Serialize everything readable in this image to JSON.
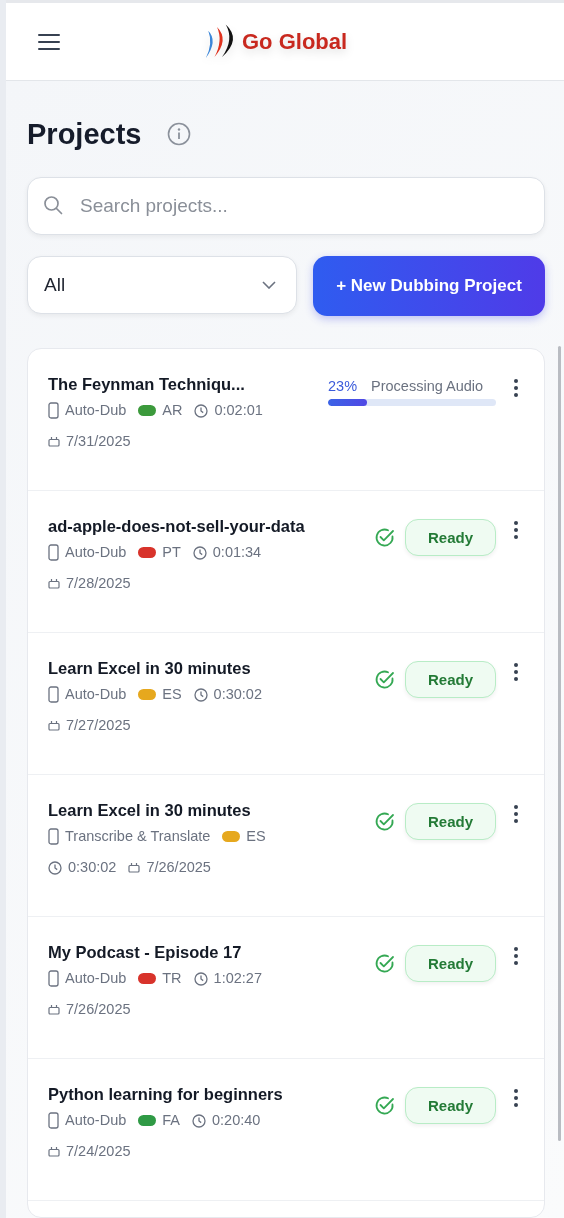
{
  "header": {
    "logo": "Go Global"
  },
  "page": {
    "title": "Projects"
  },
  "search": {
    "placeholder": "Search projects..."
  },
  "filter": {
    "value": "All"
  },
  "new_button": {
    "label": "+ New Dubbing Project"
  },
  "projects": [
    {
      "title": "The Feynman Techniqu...",
      "mode": "Auto-Dub",
      "language": {
        "code": "AR",
        "color": "#3c9a3c"
      },
      "duration": "0:02:01",
      "date": "7/31/2025",
      "status": {
        "kind": "processing",
        "percent": "23%",
        "label": "Processing Audio",
        "level": 0.23
      }
    },
    {
      "title": "ad-apple-does-not-sell-your-data",
      "mode": "Auto-Dub",
      "language": {
        "code": "PT",
        "color": "#d8332b"
      },
      "duration": "0:01:34",
      "date": "7/28/2025",
      "status": {
        "kind": "ready",
        "label": "Ready"
      }
    },
    {
      "title": "Learn Excel in 30 minutes",
      "mode": "Auto-Dub",
      "language": {
        "code": "ES",
        "color": "#e6a81e"
      },
      "duration": "0:30:02",
      "date": "7/27/2025",
      "status": {
        "kind": "ready",
        "label": "Ready"
      }
    },
    {
      "title": "Learn Excel in 30 minutes",
      "mode": "Transcribe & Translate",
      "language": {
        "code": "ES",
        "color": "#e6a81e"
      },
      "duration": "0:30:02",
      "date": "7/26/2025",
      "status": {
        "kind": "ready",
        "label": "Ready"
      }
    },
    {
      "title": "My Podcast - Episode 17",
      "mode": "Auto-Dub",
      "language": {
        "code": "TR",
        "color": "#d8332b"
      },
      "duration": "1:02:27",
      "date": "7/26/2025",
      "status": {
        "kind": "ready",
        "label": "Ready"
      }
    },
    {
      "title": "Python learning for beginners",
      "mode": "Auto-Dub",
      "language": {
        "code": "FA",
        "color": "#2f9a45"
      },
      "duration": "0:20:40",
      "date": "7/24/2025",
      "status": {
        "kind": "ready",
        "label": "Ready"
      }
    }
  ]
}
